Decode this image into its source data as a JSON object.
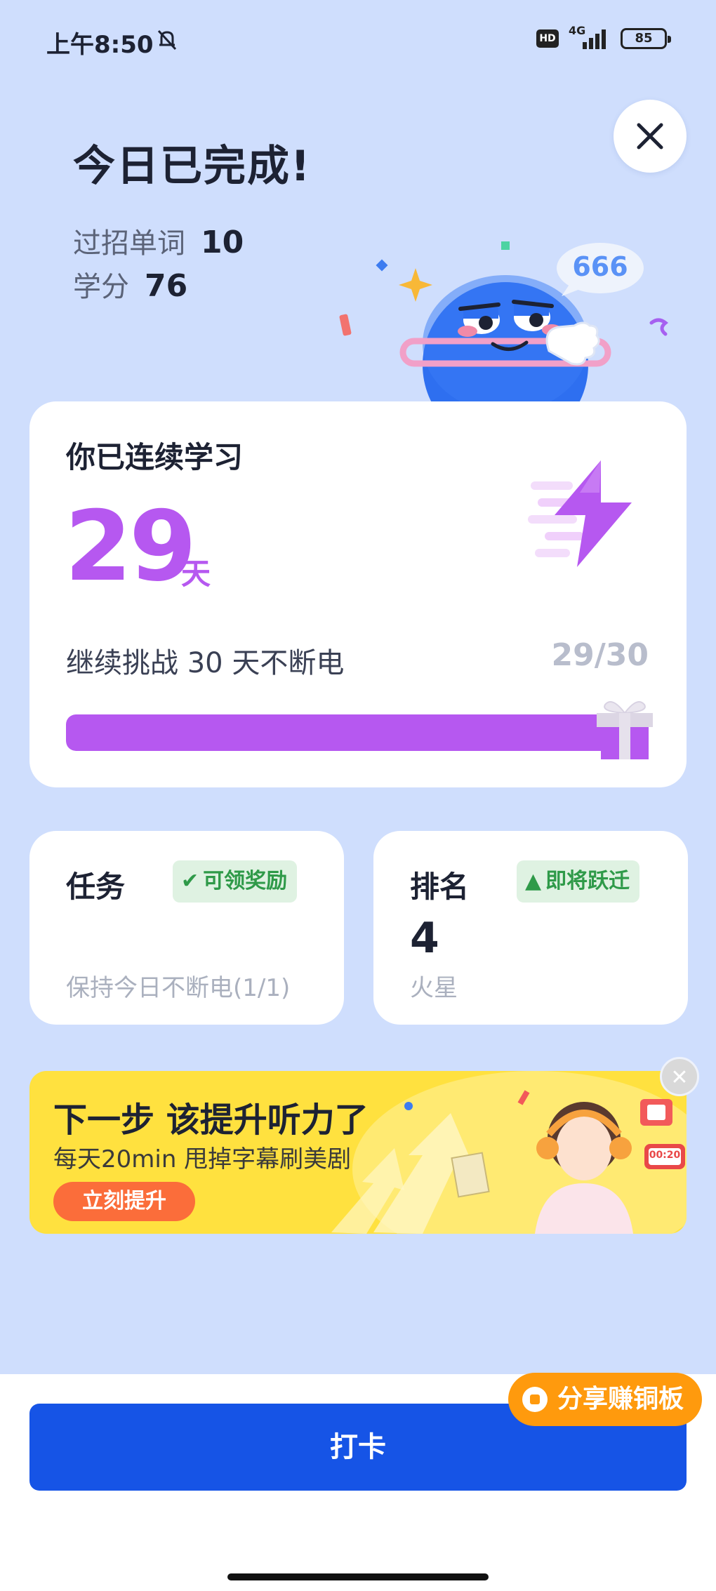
{
  "status_bar": {
    "time": "上午8:50",
    "hd": "HD",
    "network": "4G",
    "battery": "85"
  },
  "header": {
    "title": "今日已完成!",
    "stats": [
      {
        "label": "过招单词",
        "value": "10"
      },
      {
        "label": "学分",
        "value": "76"
      }
    ],
    "bubble": "666"
  },
  "streak": {
    "label": "你已连续学习",
    "days": "29",
    "unit": "天",
    "challenge": "继续挑战 30 天不断电",
    "progress_text": "29/30",
    "progress_fraction": 0.967
  },
  "task_card": {
    "title": "任务",
    "badge": "可领奖励",
    "desc": "保持今日不断电(1/1)"
  },
  "rank_card": {
    "title": "排名",
    "badge": "即将跃迁",
    "rank": "4",
    "planet": "火星"
  },
  "banner": {
    "title": "下一步 该提升听力了",
    "subtitle": "每天20min 甩掉字幕刷美剧",
    "button": "立刻提升",
    "timer_label": "00:20"
  },
  "bottom": {
    "share": "分享赚铜板",
    "checkin": "打卡"
  },
  "colors": {
    "background": "#cfdefd",
    "accent_purple": "#b658f0",
    "primary_blue": "#1654e6",
    "badge_green": "#2f9a49",
    "banner_yellow": "#ffe13f",
    "share_orange": "#ff9a0d"
  }
}
